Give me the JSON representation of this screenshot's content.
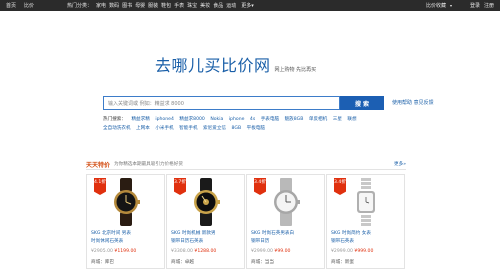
{
  "topbar": {
    "links": [
      "首页",
      "比价"
    ],
    "category_title": "热门分类：",
    "categories": [
      "家电",
      "数码",
      "图书",
      "母婴",
      "服装",
      "鞋包",
      "手表",
      "珠宝",
      "美妆",
      "食品",
      "运动"
    ],
    "more": "更多▾",
    "favorite": "比价收藏",
    "favorite_arrow": "▾",
    "login": "登录",
    "register": "注册"
  },
  "logo": {
    "brand": "去哪儿买比价网",
    "slogan": "网上购物 先比再买"
  },
  "search": {
    "placeholder": "输入关键词或 例如：精益求 8000",
    "button": "搜 索",
    "help": "使用帮助  意见反馈"
  },
  "hot": {
    "title": "热门搜索：",
    "words": [
      "精益求精",
      "iphone4",
      "精益求8000",
      "Nokia",
      "iphone",
      "4s",
      "手表电脑",
      "魅族8GB",
      "单反相机",
      "三星",
      "联想",
      "全自动洗衣机",
      "上网本",
      "小米手机",
      "智能手机",
      "索尼爱立信",
      "8GB",
      "平板电脑"
    ]
  },
  "section": {
    "title": "天天特价",
    "subtitle": "为你精选本期最具吸引力价格好货",
    "more": "更多»"
  },
  "products": [
    {
      "discount": "4.1折",
      "icon": "wristwatch-black-gold",
      "name": "SKG 北京时间 男表\n时尚休闲石英表",
      "original": "¥2905.00",
      "current": "¥1199.00",
      "mall": "库巴"
    },
    {
      "discount": "3.7折",
      "icon": "wristwatch-black-gold-2",
      "name": "SKG 时尚机械 新款男\n钢带日历石英表",
      "original": "¥3308.00",
      "current": "¥1288.00",
      "mall": "卓越"
    },
    {
      "discount": "3.4折",
      "icon": "wristwatch-silver-white",
      "name": "SKG 时尚石英男表白\n钢带日历",
      "original": "¥2999.00",
      "current": "¥99.00",
      "mall": "当当"
    },
    {
      "discount": "3.4折",
      "icon": "wristwatch-silver-bracelet",
      "name": "SKG 时尚简约 女表\n钢带石英表",
      "original": "¥2999.00",
      "current": "¥999.00",
      "mall": "新蛋"
    }
  ],
  "labels": {
    "price_prefix": "原价",
    "mall_prefix": "商城："
  },
  "colors": {
    "accent": "#1c5fb3",
    "badge": "#e0300e",
    "topbar": "#2b2b2b",
    "link": "#1a5fa8"
  }
}
